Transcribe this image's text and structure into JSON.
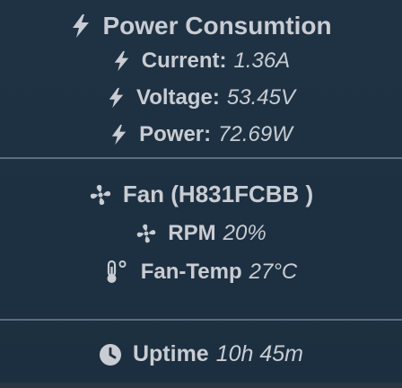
{
  "power": {
    "title": "Power Consumtion",
    "items": [
      {
        "label": "Current:",
        "value": "1.36A"
      },
      {
        "label": "Voltage:",
        "value": "53.45V"
      },
      {
        "label": "Power:",
        "value": "72.69W"
      }
    ]
  },
  "fan": {
    "title": "Fan (H831FCBB )",
    "rpm_label": "RPM",
    "rpm_value": "20%",
    "temp_label": "Fan-Temp",
    "temp_value": "27°C"
  },
  "uptime": {
    "label": "Uptime",
    "value": "10h 45m"
  },
  "icons": {
    "power": "bolt-icon",
    "fan": "fan-icon",
    "temperature": "thermometer-icon",
    "uptime": "clock-icon"
  },
  "colors": {
    "background": "#1d3041",
    "text": "#c9ccd2",
    "divider": "#5d6d7d"
  }
}
